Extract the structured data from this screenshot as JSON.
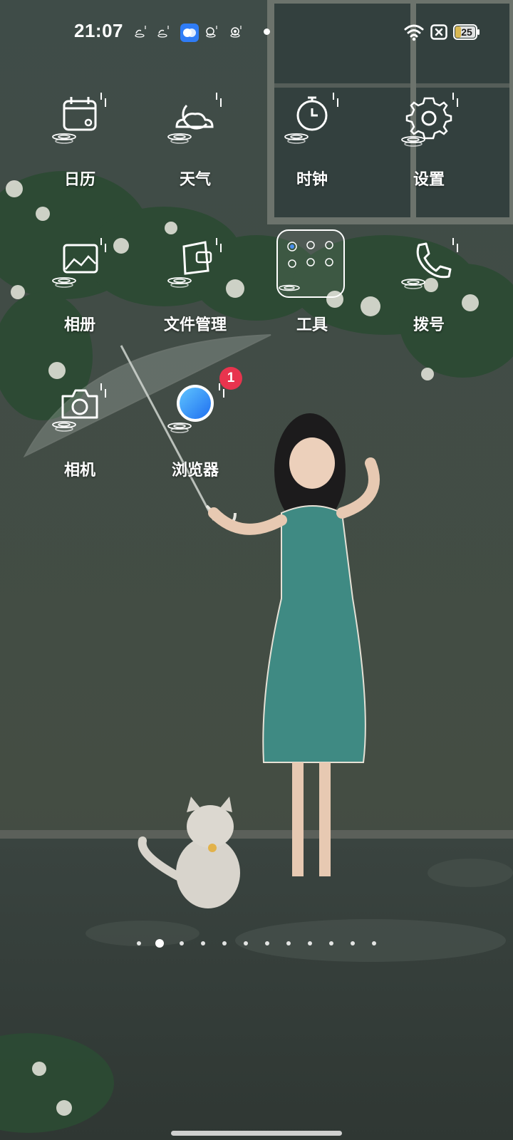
{
  "status_bar": {
    "time": "21:07",
    "notification_icons": [
      "rain-widget-icon",
      "rain-widget-icon",
      "app-notification-icon",
      "rain-widget-icon",
      "rain-widget-icon"
    ],
    "battery_level": "25",
    "wifi": "wifi-icon",
    "sim": "no-sim-icon"
  },
  "home": {
    "apps": [
      {
        "label": "日历",
        "icon": "calendar-icon"
      },
      {
        "label": "天气",
        "icon": "weather-icon"
      },
      {
        "label": "时钟",
        "icon": "clock-icon"
      },
      {
        "label": "设置",
        "icon": "settings-icon"
      },
      {
        "label": "相册",
        "icon": "gallery-icon"
      },
      {
        "label": "文件管理",
        "icon": "file-manager-icon"
      },
      {
        "label": "工具",
        "icon": "tools-folder-icon"
      },
      {
        "label": "拨号",
        "icon": "phone-icon"
      },
      {
        "label": "相机",
        "icon": "camera-icon"
      },
      {
        "label": "浏览器",
        "icon": "browser-icon",
        "badge": "1"
      }
    ],
    "page_indicator": {
      "total": 12,
      "active": 2
    }
  },
  "colors": {
    "badge": "#e8344e",
    "browser_blue": "#2f8ef6",
    "wallpaper_wall": "#3e4a44"
  }
}
